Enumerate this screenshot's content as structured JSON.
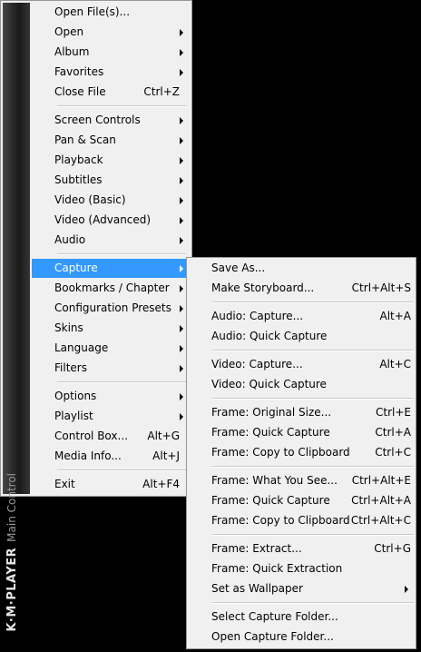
{
  "brand": {
    "logo": "K·M·PLAYER",
    "subtitle": "Main Control"
  },
  "main_menu": {
    "items": [
      {
        "label": "Open File(s)...",
        "shortcut": "",
        "submenu": false
      },
      {
        "label": "Open",
        "shortcut": "",
        "submenu": true
      },
      {
        "label": "Album",
        "shortcut": "",
        "submenu": true
      },
      {
        "label": "Favorites",
        "shortcut": "",
        "submenu": true
      },
      {
        "label": "Close File",
        "shortcut": "Ctrl+Z",
        "submenu": false
      },
      {
        "label": "Screen Controls",
        "shortcut": "",
        "submenu": true
      },
      {
        "label": "Pan & Scan",
        "shortcut": "",
        "submenu": true
      },
      {
        "label": "Playback",
        "shortcut": "",
        "submenu": true
      },
      {
        "label": "Subtitles",
        "shortcut": "",
        "submenu": true
      },
      {
        "label": "Video (Basic)",
        "shortcut": "",
        "submenu": true
      },
      {
        "label": "Video (Advanced)",
        "shortcut": "",
        "submenu": true
      },
      {
        "label": "Audio",
        "shortcut": "",
        "submenu": true
      },
      {
        "label": "Capture",
        "shortcut": "",
        "submenu": true,
        "active": true
      },
      {
        "label": "Bookmarks / Chapter",
        "shortcut": "",
        "submenu": true
      },
      {
        "label": "Configuration Presets",
        "shortcut": "",
        "submenu": true
      },
      {
        "label": "Skins",
        "shortcut": "",
        "submenu": true
      },
      {
        "label": "Language",
        "shortcut": "",
        "submenu": true
      },
      {
        "label": "Filters",
        "shortcut": "",
        "submenu": true
      },
      {
        "label": "Options",
        "shortcut": "",
        "submenu": true
      },
      {
        "label": "Playlist",
        "shortcut": "",
        "submenu": true
      },
      {
        "label": "Control Box...",
        "shortcut": "Alt+G",
        "submenu": false
      },
      {
        "label": "Media Info...",
        "shortcut": "Alt+J",
        "submenu": false
      },
      {
        "label": "Exit",
        "shortcut": "Alt+F4",
        "submenu": false
      }
    ]
  },
  "capture_menu": {
    "items": [
      {
        "label": "Save As...",
        "shortcut": "",
        "submenu": false
      },
      {
        "label": "Make Storyboard...",
        "shortcut": "Ctrl+Alt+S",
        "submenu": false
      },
      {
        "label": "Audio: Capture...",
        "shortcut": "Alt+A",
        "submenu": false
      },
      {
        "label": "Audio: Quick Capture",
        "shortcut": "",
        "submenu": false
      },
      {
        "label": "Video: Capture...",
        "shortcut": "Alt+C",
        "submenu": false
      },
      {
        "label": "Video: Quick Capture",
        "shortcut": "",
        "submenu": false
      },
      {
        "label": "Frame: Original Size...",
        "shortcut": "Ctrl+E",
        "submenu": false
      },
      {
        "label": "Frame: Quick Capture",
        "shortcut": "Ctrl+A",
        "submenu": false
      },
      {
        "label": "Frame: Copy to Clipboard",
        "shortcut": "Ctrl+C",
        "submenu": false
      },
      {
        "label": "Frame: What You See...",
        "shortcut": "Ctrl+Alt+E",
        "submenu": false
      },
      {
        "label": "Frame: Quick Capture",
        "shortcut": "Ctrl+Alt+A",
        "submenu": false
      },
      {
        "label": "Frame: Copy to Clipboard",
        "shortcut": "Ctrl+Alt+C",
        "submenu": false
      },
      {
        "label": "Frame: Extract...",
        "shortcut": "Ctrl+G",
        "submenu": false
      },
      {
        "label": "Frame: Quick Extraction",
        "shortcut": "",
        "submenu": false
      },
      {
        "label": "Set as Wallpaper",
        "shortcut": "",
        "submenu": true
      },
      {
        "label": "Select Capture Folder...",
        "shortcut": "",
        "submenu": false
      },
      {
        "label": "Open Capture Folder...",
        "shortcut": "",
        "submenu": false
      }
    ]
  },
  "colors": {
    "highlight": "#3399ff",
    "menu_bg": "#f0f0f0",
    "background": "#000000"
  }
}
